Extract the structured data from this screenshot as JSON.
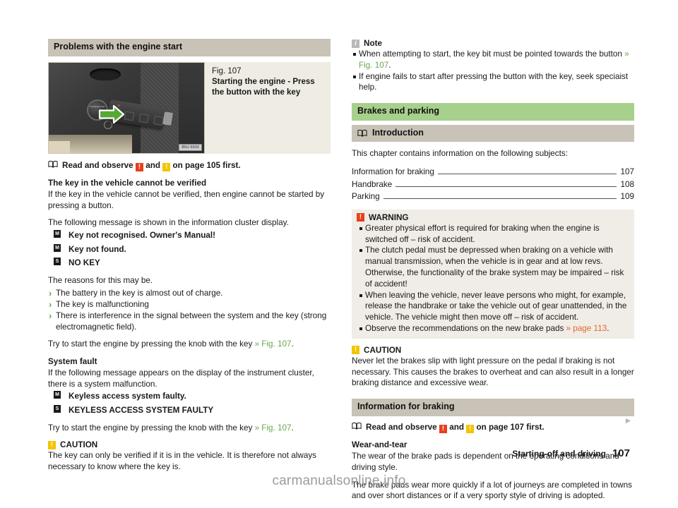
{
  "left": {
    "section_title": "Problems with the engine start",
    "figure": {
      "number": "Fig. 107",
      "caption": "Starting the engine - Press the button with the key",
      "image_tag": "BNJ-0003",
      "button_text": "Press Engine Start"
    },
    "observe_line": {
      "prefix": "Read and observe",
      "and": "and",
      "suffix": "on page 105 first.",
      "badge_red": "!",
      "badge_yellow": "!"
    },
    "heading_key_not_verified": "The key in the vehicle cannot be verified",
    "para_key_not_verified": "If the key in the vehicle cannot be verified, then engine cannot be started by pressing a button.",
    "para_following_message": "The following message is shown in the information cluster display.",
    "messages_1": [
      {
        "icon": "M",
        "text": "Key not recognised. Owner's Manual!"
      },
      {
        "icon": "M",
        "text": "Key not found."
      },
      {
        "icon": "S",
        "text": "NO KEY"
      }
    ],
    "para_reasons": "The reasons for this may be.",
    "reasons": [
      "The battery in the key is almost out of charge.",
      "The key is malfunctioning",
      "There is interference in the signal between the system and the key (strong electromagnetic field)."
    ],
    "para_try_1_pre": "Try to start the engine by pressing the knob with the key ",
    "para_try_1_ref": "» Fig. 107",
    "para_try_1_post": ".",
    "heading_system_fault": "System fault",
    "para_system_fault": "If the following message appears on the display of the instrument cluster, there is a system malfunction.",
    "messages_2": [
      {
        "icon": "M",
        "text": "Keyless access system faulty."
      },
      {
        "icon": "S",
        "text": "KEYLESS ACCESS SYSTEM FAULTY"
      }
    ],
    "para_try_2_pre": "Try to start the engine by pressing the knob with the key ",
    "para_try_2_ref": "» Fig. 107",
    "para_try_2_post": ".",
    "caution": {
      "title": "CAUTION",
      "body": "The key can only be verified if it is in the vehicle. It is therefore not always necessary to know where the key is."
    }
  },
  "right": {
    "note": {
      "title": "Note",
      "items": [
        {
          "pre": "When attempting to start, the key bit must be pointed towards the button ",
          "ref": "» Fig. 107",
          "post": "."
        },
        {
          "pre": "If engine fails to start after pressing the button with the key, seek speciaist help.",
          "ref": "",
          "post": ""
        }
      ]
    },
    "chapter_title": "Brakes and parking",
    "introduction_title": "Introduction",
    "intro_lead": "This chapter contains information on the following subjects:",
    "toc": [
      {
        "title": "Information for braking",
        "page": "107"
      },
      {
        "title": "Handbrake",
        "page": "108"
      },
      {
        "title": "Parking",
        "page": "109"
      }
    ],
    "warning": {
      "title": "WARNING",
      "items": [
        {
          "text": "Greater physical effort is required for braking when the engine is switched off – risk of accident.",
          "ref": "",
          "post": ""
        },
        {
          "text": "The clutch pedal must be depressed when braking on a vehicle with manual transmission, when the vehicle is in gear and at low revs. Otherwise, the functionality of the brake system may be impaired – risk of accident!",
          "ref": "",
          "post": ""
        },
        {
          "text": "When leaving the vehicle, never leave persons who might, for example, release the handbrake or take the vehicle out of gear unattended, in the vehicle. The vehicle might then move off – risk of accident.",
          "ref": "",
          "post": ""
        },
        {
          "text": "Observe the recommendations on the new brake pads ",
          "ref": "» page 113",
          "post": "."
        }
      ]
    },
    "caution": {
      "title": "CAUTION",
      "body": "Never let the brakes slip with light pressure on the pedal if braking is not necessary. This causes the brakes to overheat and can also result in a longer braking distance and excessive wear."
    },
    "info_braking_title": "Information for braking",
    "observe_line": {
      "prefix": "Read and observe",
      "and": "and",
      "suffix": "on page 107 first.",
      "badge_red": "!",
      "badge_yellow": "!"
    },
    "heading_wear": "Wear-and-tear",
    "para_wear_1": "The wear of the brake pads is dependent on the operating conditions and driving style.",
    "para_wear_2": "The brake pads wear more quickly if a lot of journeys are completed in towns and over short distances or if a very sporty style of driving is adopted."
  },
  "footer": {
    "chapter": "Starting-off and driving",
    "page_number": "107"
  },
  "watermark": "carmanualsonline.info",
  "colors": {
    "chapter_header": "#a8d08d",
    "section_header": "#c9c2b6",
    "warning_bg": "#f0ece6",
    "green_ref": "#6aa84f",
    "orange_ref": "#e06a2b",
    "red_badge": "#e8401f",
    "yellow_badge": "#f5c400"
  }
}
